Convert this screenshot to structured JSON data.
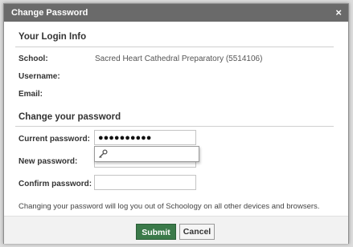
{
  "dialog": {
    "title": "Change Password",
    "close_glyph": "×"
  },
  "login_info": {
    "heading": "Your Login Info",
    "school_label": "School:",
    "school_value": "Sacred Heart Cathedral Preparatory (5514106)",
    "username_label": "Username:",
    "email_label": "Email:"
  },
  "change_password": {
    "heading": "Change your password",
    "current_label": "Current password:",
    "current_value": "●●●●●●●●●●",
    "new_label": "New password:",
    "confirm_label": "Confirm password:"
  },
  "autofill": {
    "icon": "key-icon"
  },
  "note": "Changing your password will log you out of Schoology on all other devices and browsers.",
  "buttons": {
    "submit": "Submit",
    "cancel": "Cancel"
  },
  "colors": {
    "titlebar": "#6a6a6a",
    "submit": "#3b7a4a"
  }
}
